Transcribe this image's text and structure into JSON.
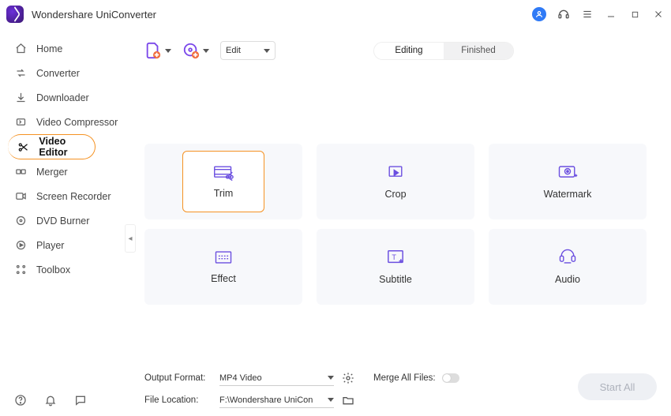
{
  "app": {
    "title": "Wondershare UniConverter"
  },
  "sidebar": {
    "items": [
      {
        "label": "Home"
      },
      {
        "label": "Converter"
      },
      {
        "label": "Downloader"
      },
      {
        "label": "Video Compressor"
      },
      {
        "label": "Video Editor"
      },
      {
        "label": "Merger"
      },
      {
        "label": "Screen Recorder"
      },
      {
        "label": "DVD Burner"
      },
      {
        "label": "Player"
      },
      {
        "label": "Toolbox"
      }
    ]
  },
  "toolbar": {
    "mode_select": "Edit",
    "tabs": {
      "editing": "Editing",
      "finished": "Finished",
      "active": "editing"
    }
  },
  "tools": {
    "trim": "Trim",
    "crop": "Crop",
    "watermark": "Watermark",
    "effect": "Effect",
    "subtitle": "Subtitle",
    "audio": "Audio",
    "selected": "trim"
  },
  "footer": {
    "output_format_label": "Output Format:",
    "output_format_value": "MP4 Video",
    "file_location_label": "File Location:",
    "file_location_value": "F:\\Wondershare UniConverter",
    "merge_label": "Merge All Files:",
    "merge_on": false,
    "start_label": "Start All"
  },
  "colors": {
    "accent_orange": "#f59223",
    "icon_purple": "#6b4fe0"
  }
}
